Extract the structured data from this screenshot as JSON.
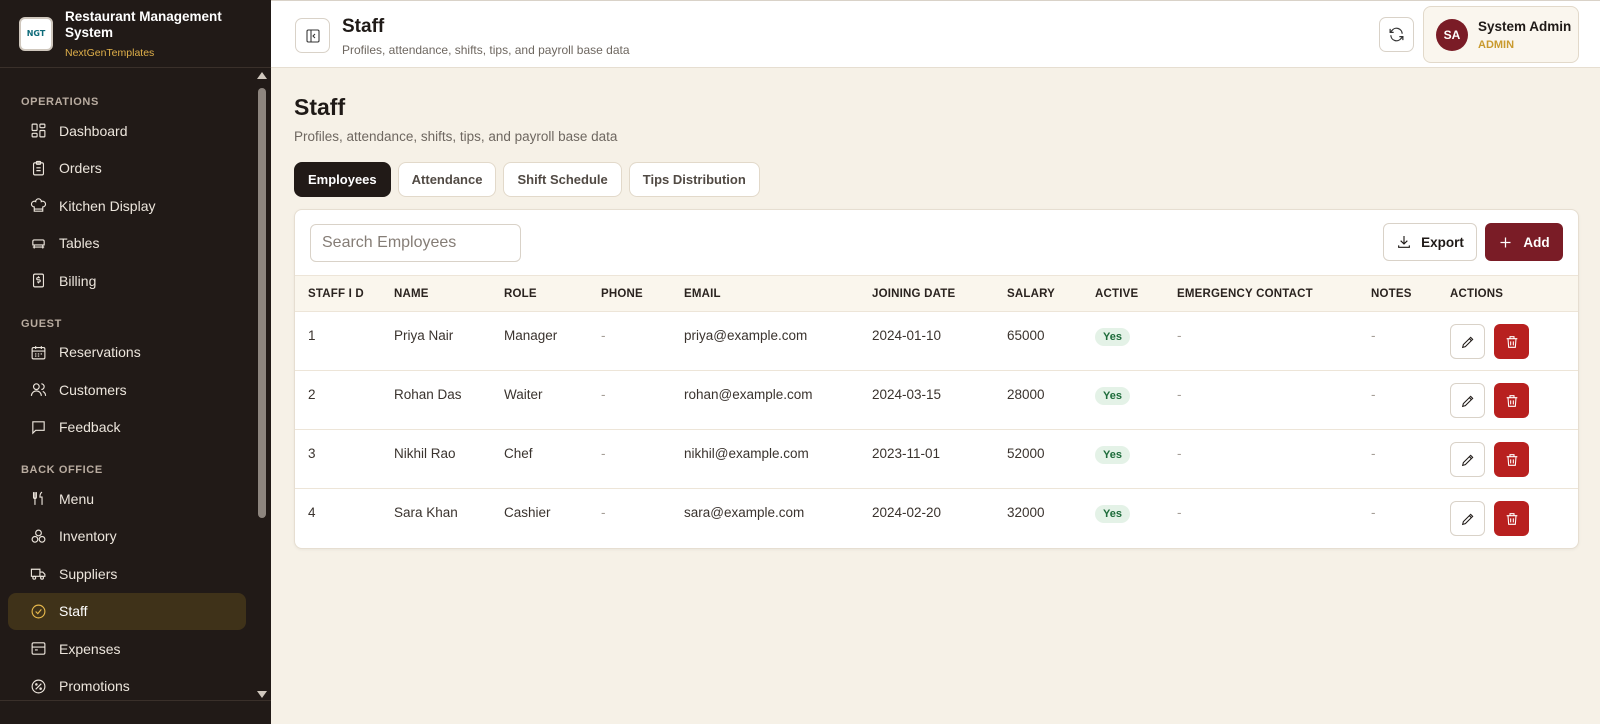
{
  "brand": {
    "title": "Restaurant Management System",
    "subtitle": "NextGenTemplates",
    "logo_text": "NGT"
  },
  "sidebar": {
    "sections": [
      {
        "label": "OPERATIONS",
        "items": [
          {
            "label": "Dashboard",
            "icon": "dashboard-icon"
          },
          {
            "label": "Orders",
            "icon": "clipboard-icon"
          },
          {
            "label": "Kitchen Display",
            "icon": "chef-hat-icon"
          },
          {
            "label": "Tables",
            "icon": "table-icon"
          },
          {
            "label": "Billing",
            "icon": "receipt-icon"
          }
        ]
      },
      {
        "label": "GUEST",
        "items": [
          {
            "label": "Reservations",
            "icon": "calendar-icon"
          },
          {
            "label": "Customers",
            "icon": "users-icon"
          },
          {
            "label": "Feedback",
            "icon": "message-icon"
          }
        ]
      },
      {
        "label": "BACK OFFICE",
        "items": [
          {
            "label": "Menu",
            "icon": "utensils-icon"
          },
          {
            "label": "Inventory",
            "icon": "boxes-icon"
          },
          {
            "label": "Suppliers",
            "icon": "truck-icon"
          },
          {
            "label": "Staff",
            "icon": "badge-check-icon",
            "active": true
          },
          {
            "label": "Expenses",
            "icon": "wallet-icon"
          },
          {
            "label": "Promotions",
            "icon": "percent-icon"
          }
        ]
      }
    ]
  },
  "header": {
    "title": "Staff",
    "subtitle": "Profiles, attendance, shifts, tips, and payroll base data"
  },
  "user": {
    "initials": "SA",
    "name": "System Admin",
    "role": "ADMIN"
  },
  "page": {
    "title": "Staff",
    "subtitle": "Profiles, attendance, shifts, tips, and payroll base data",
    "tabs": [
      {
        "label": "Employees",
        "active": true
      },
      {
        "label": "Attendance"
      },
      {
        "label": "Shift Schedule"
      },
      {
        "label": "Tips Distribution"
      }
    ]
  },
  "toolbar": {
    "search_placeholder": "Search Employees",
    "export_label": "Export",
    "add_label": "Add"
  },
  "table": {
    "columns": [
      "STAFF I D",
      "NAME",
      "ROLE",
      "PHONE",
      "EMAIL",
      "JOINING DATE",
      "SALARY",
      "ACTIVE",
      "EMERGENCY CONTACT",
      "NOTES",
      "ACTIONS"
    ],
    "rows": [
      {
        "id": "1",
        "name": "Priya Nair",
        "role": "Manager",
        "phone": "-",
        "email": "priya@example.com",
        "joining_date": "2024-01-10",
        "salary": "65000",
        "active": "Yes",
        "emergency": "-",
        "notes": "-"
      },
      {
        "id": "2",
        "name": "Rohan Das",
        "role": "Waiter",
        "phone": "-",
        "email": "rohan@example.com",
        "joining_date": "2024-03-15",
        "salary": "28000",
        "active": "Yes",
        "emergency": "-",
        "notes": "-"
      },
      {
        "id": "3",
        "name": "Nikhil Rao",
        "role": "Chef",
        "phone": "-",
        "email": "nikhil@example.com",
        "joining_date": "2023-11-01",
        "salary": "52000",
        "active": "Yes",
        "emergency": "-",
        "notes": "-"
      },
      {
        "id": "4",
        "name": "Sara Khan",
        "role": "Cashier",
        "phone": "-",
        "email": "sara@example.com",
        "joining_date": "2024-02-20",
        "salary": "32000",
        "active": "Yes",
        "emergency": "-",
        "notes": "-"
      }
    ]
  },
  "colors": {
    "sidebar_bg": "#211a17",
    "accent": "#7a1c26",
    "gold": "#e0b04a",
    "delete": "#b8201f",
    "page_bg": "#f6f1e7"
  }
}
